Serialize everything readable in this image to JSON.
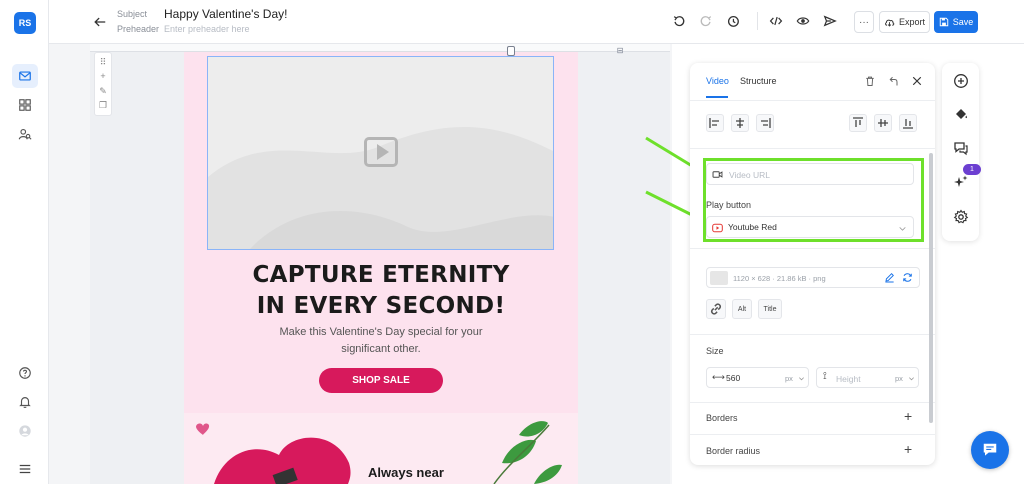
{
  "app": {
    "logo_text": "RS"
  },
  "sidebar": {
    "items": [
      {
        "icon": "mail-icon",
        "active": true
      },
      {
        "icon": "templates-icon",
        "active": false
      },
      {
        "icon": "contacts-icon",
        "active": false
      }
    ],
    "bottom": [
      "help-icon",
      "bell-icon",
      "avatar-icon",
      "menu-icon"
    ]
  },
  "header": {
    "subject_label": "Subject",
    "subject_value": "Happy Valentine's Day!",
    "preheader_label": "Preheader",
    "preheader_placeholder": "Enter preheader here",
    "more_label": "···",
    "export_label": "Export",
    "save_label": "Save",
    "icons": [
      "undo-icon",
      "redo-icon",
      "history-icon",
      "code-icon",
      "preview-icon",
      "send-icon"
    ]
  },
  "email": {
    "headline_1": "CAPTURE ETERNITY",
    "headline_2": "IN EVERY SECOND!",
    "subtext_1": "Make this Valentine's Day special for your",
    "subtext_2": "significant other.",
    "cta": "SHOP SALE",
    "next_heading": "Always near"
  },
  "panel": {
    "tab_video": "Video",
    "tab_structure": "Structure",
    "video_url_placeholder": "Video URL",
    "play_button_label": "Play button",
    "play_button_value": "Youtube Red",
    "image_meta": "1120 × 628 · 21.86 kB · png",
    "alt_label": "Alt",
    "title_label": "Title",
    "size_label": "Size",
    "width_value": "560",
    "width_unit": "px",
    "height_placeholder": "Height",
    "height_unit": "px",
    "borders_label": "Borders",
    "border_radius_label": "Border radius",
    "colors": {
      "accent": "#1a73e8",
      "highlight": "#6ee02b",
      "cta": "#d7195c"
    }
  },
  "rail": {
    "badge": "1",
    "icons": [
      "add-icon",
      "paint-bucket-icon",
      "comments-icon",
      "ai-sparkle-icon",
      "settings-icon"
    ]
  }
}
